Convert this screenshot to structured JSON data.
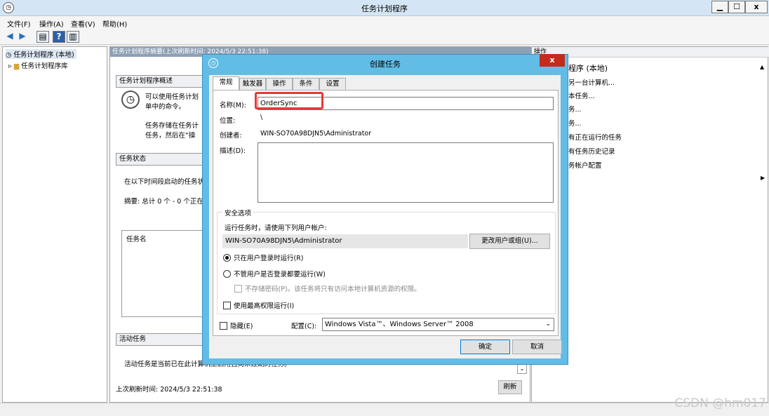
{
  "window": {
    "title": "任务计划程序",
    "minimize": "▁",
    "maximize": "☐",
    "close": "x"
  },
  "menu": [
    "文件(F)",
    "操作(A)",
    "查看(V)",
    "帮助(H)"
  ],
  "toolbar": {
    "back": "◀",
    "forward": "▶"
  },
  "tree": {
    "root": "任务计划程序 (本地)",
    "child": "任务计划程序库"
  },
  "center": {
    "header": "任务计划程序摘要(上次刷新时间: 2024/5/3 22:51:38)",
    "overview_title": "任务计划程序概述",
    "overview_text1": "可以使用任务计划",
    "overview_text2": "单中的命令。",
    "overview_text3": "任务存储在任务计",
    "overview_text4": "任务，然后在“操",
    "status_title": "任务状态",
    "status_text": "在以下时间段启动的任务状",
    "summary_text": "摘要: 总计 0 个 - 0 个正在",
    "task_name_col": "任务名",
    "active_title": "活动任务",
    "active_text": "活动任务是当前已在此计算机上启用且尚未过期的任务。",
    "last_refresh": "上次刷新时间: 2024/5/3 22:51:38",
    "refresh_button": "刷新"
  },
  "actions": {
    "title": "操作",
    "section": "程序 (本地)",
    "items": [
      "另一台计算机...",
      "本任务...",
      "务...",
      "务...",
      "有正在运行的任务",
      "有任务历史记录",
      "务帐户配置"
    ]
  },
  "watermark": "CSDN @hm017",
  "dialog": {
    "title": "创建任务",
    "close": "x",
    "tabs": [
      "常规",
      "触发器",
      "操作",
      "条件",
      "设置"
    ],
    "name_label": "名称(M):",
    "name_value": "OrderSync",
    "location_label": "位置:",
    "location_value": "\\",
    "author_label": "创建者:",
    "author_value": "WIN-SO70A98DJN5\\Administrator",
    "description_label": "描述(D):",
    "security_title": "安全选项",
    "run_as_text": "运行任务时，请使用下列用户帐户:",
    "user_value": "WIN-SO70A98DJN5\\Administrator",
    "change_user_button": "更改用户或组(U)...",
    "radio_logged_on": "只在用户登录时运行(R)",
    "radio_whether": "不管用户是否登录都要运行(W)",
    "no_store_password": "不存储密码(P)。该任务将只有访问本地计算机资源的权限。",
    "highest_privileges": "使用最高权限运行(I)",
    "hidden_label": "隐藏(E)",
    "configure_label": "配置(C):",
    "configure_value": "Windows Vista™、Windows Server™ 2008",
    "ok_button": "确定",
    "cancel_button": "取消"
  }
}
